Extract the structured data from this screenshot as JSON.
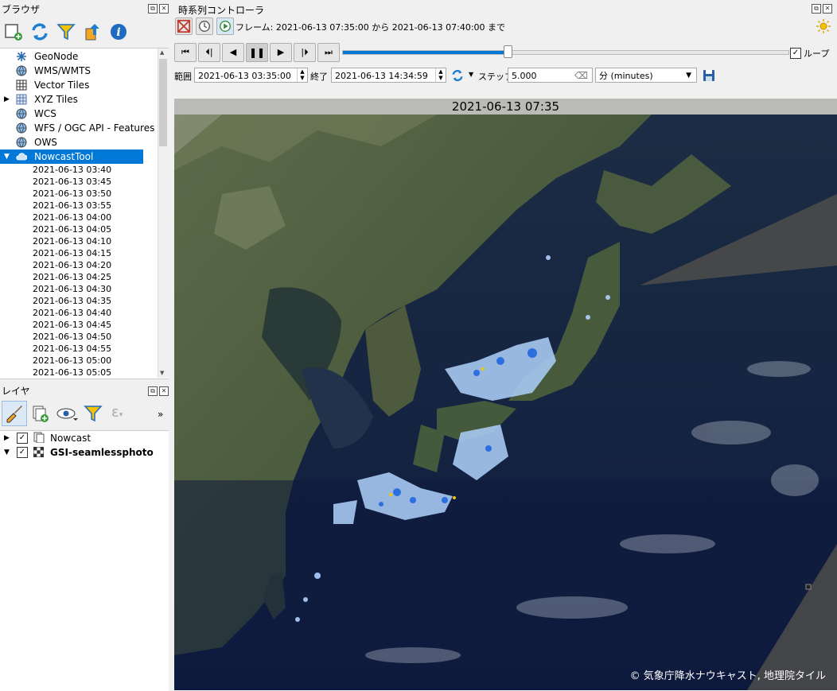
{
  "browser": {
    "title": "ブラウザ",
    "toolbar_icons": [
      "add-layer-icon",
      "refresh-icon",
      "filter-icon",
      "collapse-icon",
      "info-icon"
    ],
    "items": [
      {
        "label": "GeoNode",
        "icon": "geonode-icon"
      },
      {
        "label": "WMS/WMTS",
        "icon": "globe-icon"
      },
      {
        "label": "Vector Tiles",
        "icon": "grid-icon"
      },
      {
        "label": "XYZ Tiles",
        "icon": "grid-icon"
      },
      {
        "label": "WCS",
        "icon": "globe-icon"
      },
      {
        "label": "WFS / OGC API - Features",
        "icon": "globe-icon"
      },
      {
        "label": "OWS",
        "icon": "globe-icon"
      },
      {
        "label": "NowcastTool",
        "icon": "cloud-icon",
        "selected": true
      }
    ],
    "timestamps": [
      "2021-06-13 03:40",
      "2021-06-13 03:45",
      "2021-06-13 03:50",
      "2021-06-13 03:55",
      "2021-06-13 04:00",
      "2021-06-13 04:05",
      "2021-06-13 04:10",
      "2021-06-13 04:15",
      "2021-06-13 04:20",
      "2021-06-13 04:25",
      "2021-06-13 04:30",
      "2021-06-13 04:35",
      "2021-06-13 04:40",
      "2021-06-13 04:45",
      "2021-06-13 04:50",
      "2021-06-13 04:55",
      "2021-06-13 05:00",
      "2021-06-13 05:05"
    ]
  },
  "layers": {
    "title": "レイヤ",
    "items": [
      {
        "label": "Nowcast",
        "checked": true,
        "bold": false
      },
      {
        "label": "GSI-seamlessphoto",
        "checked": true,
        "bold": true
      }
    ]
  },
  "time_controller": {
    "title": "時系列コントローラ",
    "frame_text": "フレーム: 2021-06-13 07:35:00 から 2021-06-13 07:40:00 まで",
    "loop_label": "ループ",
    "range_label": "範囲",
    "range_start": "2021-06-13 03:35:00",
    "end_label": "終了",
    "range_end": "2021-06-13 14:34:59",
    "step_label": "ステップ",
    "step_value": "5.000",
    "unit_value": "分 (minutes)",
    "slider_fraction": 0.37,
    "accent": "#0078d7"
  },
  "map": {
    "timestamp": "2021-06-13 07:35",
    "attribution": "© 気象庁降水ナウキャスト, 地理院タイル"
  }
}
